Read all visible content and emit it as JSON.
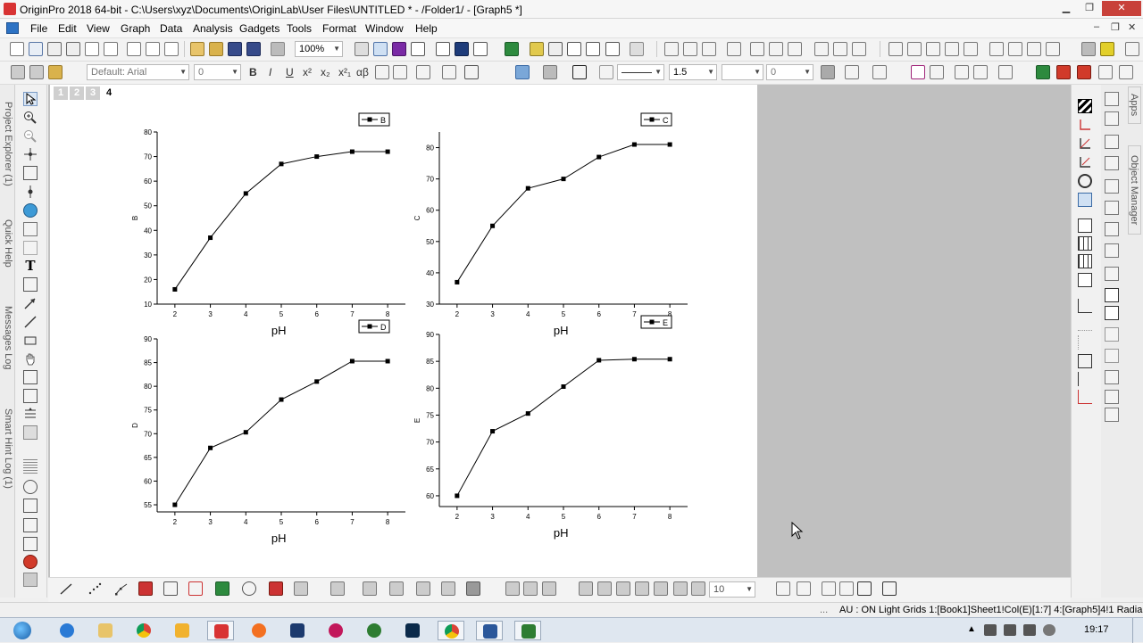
{
  "window": {
    "title": "OriginPro 2018 64-bit - C:\\Users\\xyz\\Documents\\OriginLab\\User Files\\UNTITLED * - /Folder1/ - [Graph5 *]",
    "minimize": "▁",
    "maximize": "❐",
    "close": "✕"
  },
  "menu": {
    "items": [
      "File",
      "Edit",
      "View",
      "Graph",
      "Data",
      "Analysis",
      "Gadgets",
      "Tools",
      "Format",
      "Window",
      "Help"
    ],
    "mdi_controls": [
      "–",
      "❐",
      "✕"
    ]
  },
  "toolbar1": {
    "zoom": "100%"
  },
  "toolbar2": {
    "font": "Default: Arial",
    "font_size": "0",
    "bold": "B",
    "italic": "I",
    "underline": "U",
    "superscript": "x²",
    "subscript": "x₂",
    "supersub": "x²₁",
    "greek": "αβ",
    "line_width": "1.5",
    "size2": "0"
  },
  "dock_left": {
    "tabs": [
      "Project Explorer (1)",
      "Quick Help",
      "Messages Log",
      "Smart Hint Log (1)"
    ]
  },
  "dock_right": {
    "tabs": [
      "Apps",
      "Object Manager"
    ]
  },
  "graph": {
    "layer_tabs": [
      "1",
      "2",
      "3",
      "4"
    ],
    "active_layer": "4"
  },
  "bottom_toolbar": {
    "size": "10"
  },
  "status": {
    "text": "AU : ON  Light Grids  1:[Book1]Sheet1!Col(E)[1:7]  4:[Graph5]4!1  Radian"
  },
  "taskbar": {
    "time": "19:17"
  },
  "chart_data": [
    {
      "type": "line",
      "x": [
        2,
        3,
        4,
        5,
        6,
        7,
        8
      ],
      "series": [
        {
          "name": "B",
          "values": [
            16,
            37,
            55,
            67,
            70,
            72,
            72
          ]
        }
      ],
      "xlabel": "pH",
      "ylabel": "B",
      "xticks": [
        "2",
        "3",
        "4",
        "5",
        "6",
        "7",
        "8"
      ],
      "yticks": [
        "10",
        "20",
        "30",
        "40",
        "50",
        "60",
        "70",
        "80"
      ],
      "xlim": [
        1.5,
        8.5
      ],
      "ylim": [
        10,
        80
      ],
      "legend": "top-right"
    },
    {
      "type": "line",
      "x": [
        2,
        3,
        4,
        5,
        6,
        7,
        8
      ],
      "series": [
        {
          "name": "C",
          "values": [
            37,
            55,
            67,
            70,
            77,
            81,
            81
          ]
        }
      ],
      "xlabel": "pH",
      "ylabel": "C",
      "xticks": [
        "2",
        "3",
        "4",
        "5",
        "6",
        "7",
        "8"
      ],
      "yticks": [
        "30",
        "40",
        "50",
        "60",
        "70",
        "80"
      ],
      "xlim": [
        1.5,
        8.5
      ],
      "ylim": [
        30,
        85
      ],
      "legend": "top-right"
    },
    {
      "type": "line",
      "x": [
        2,
        3,
        4,
        5,
        6,
        7,
        8
      ],
      "series": [
        {
          "name": "D",
          "values": [
            55,
            67,
            70.3,
            77.2,
            81,
            85.3,
            85.3
          ]
        }
      ],
      "xlabel": "pH",
      "ylabel": "D",
      "xticks": [
        "2",
        "3",
        "4",
        "5",
        "6",
        "7",
        "8"
      ],
      "yticks": [
        "55",
        "60",
        "65",
        "70",
        "75",
        "80",
        "85",
        "90"
      ],
      "xlim": [
        1.5,
        8.5
      ],
      "ylim": [
        53.5,
        90
      ],
      "legend": "top-right"
    },
    {
      "type": "line",
      "x": [
        2,
        3,
        4,
        5,
        6,
        7,
        8
      ],
      "series": [
        {
          "name": "E",
          "values": [
            60,
            72,
            75.3,
            80.3,
            85.2,
            85.4,
            85.4
          ]
        }
      ],
      "xlabel": "pH",
      "ylabel": "E",
      "xticks": [
        "2",
        "3",
        "4",
        "5",
        "6",
        "7",
        "8"
      ],
      "yticks": [
        "60",
        "65",
        "70",
        "75",
        "80",
        "85",
        "90"
      ],
      "xlim": [
        1.5,
        8.5
      ],
      "ylim": [
        58,
        90
      ],
      "legend": "top-right"
    }
  ]
}
